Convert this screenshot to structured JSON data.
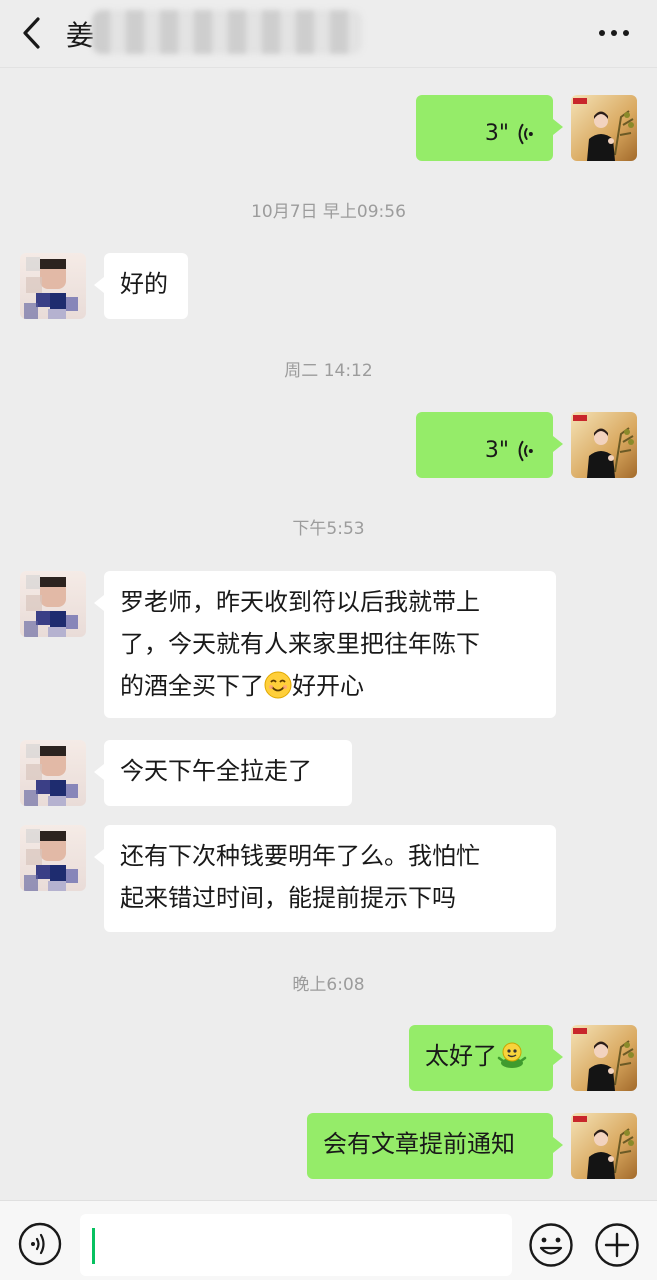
{
  "header": {
    "title": "姜",
    "more_label": "···"
  },
  "time_separators": [
    "10月7日 早上09:56",
    "周二 14:12",
    "下午5:53",
    "晚上6:08"
  ],
  "messages": {
    "voice1": {
      "duration": "3\""
    },
    "reply1": {
      "text": "好的"
    },
    "voice2": {
      "duration": "3\""
    },
    "msg1": {
      "line1": "罗老师，昨天收到符以后我就带上",
      "line2": "了，今天就有人来家里把往年陈下",
      "line3a": "的酒全买下了",
      "line3b": "好开心"
    },
    "msg2": {
      "text": "今天下午全拉走了"
    },
    "msg3": {
      "line1": "还有下次种钱要明年了么。我怕忙",
      "line2": "起来错过时间，能提前提示下吗"
    },
    "out1": {
      "text": "太好了"
    },
    "out2": {
      "text": "会有文章提前通知"
    }
  },
  "icons": {
    "back": "chevron-left-icon",
    "more": "more-dots-icon",
    "voice_wave": "voice-wave-icon",
    "smile_emoji": "smile-emoji-icon",
    "sprout_emoji": "sprout-emoji-icon",
    "voice_toggle": "voice-toggle-icon",
    "emoji_button": "emoji-face-icon",
    "plus_button": "plus-circle-icon"
  },
  "colors": {
    "background": "#ededed",
    "outgoing_bubble": "#95ec69",
    "incoming_bubble": "#ffffff",
    "cursor": "#07c160"
  }
}
